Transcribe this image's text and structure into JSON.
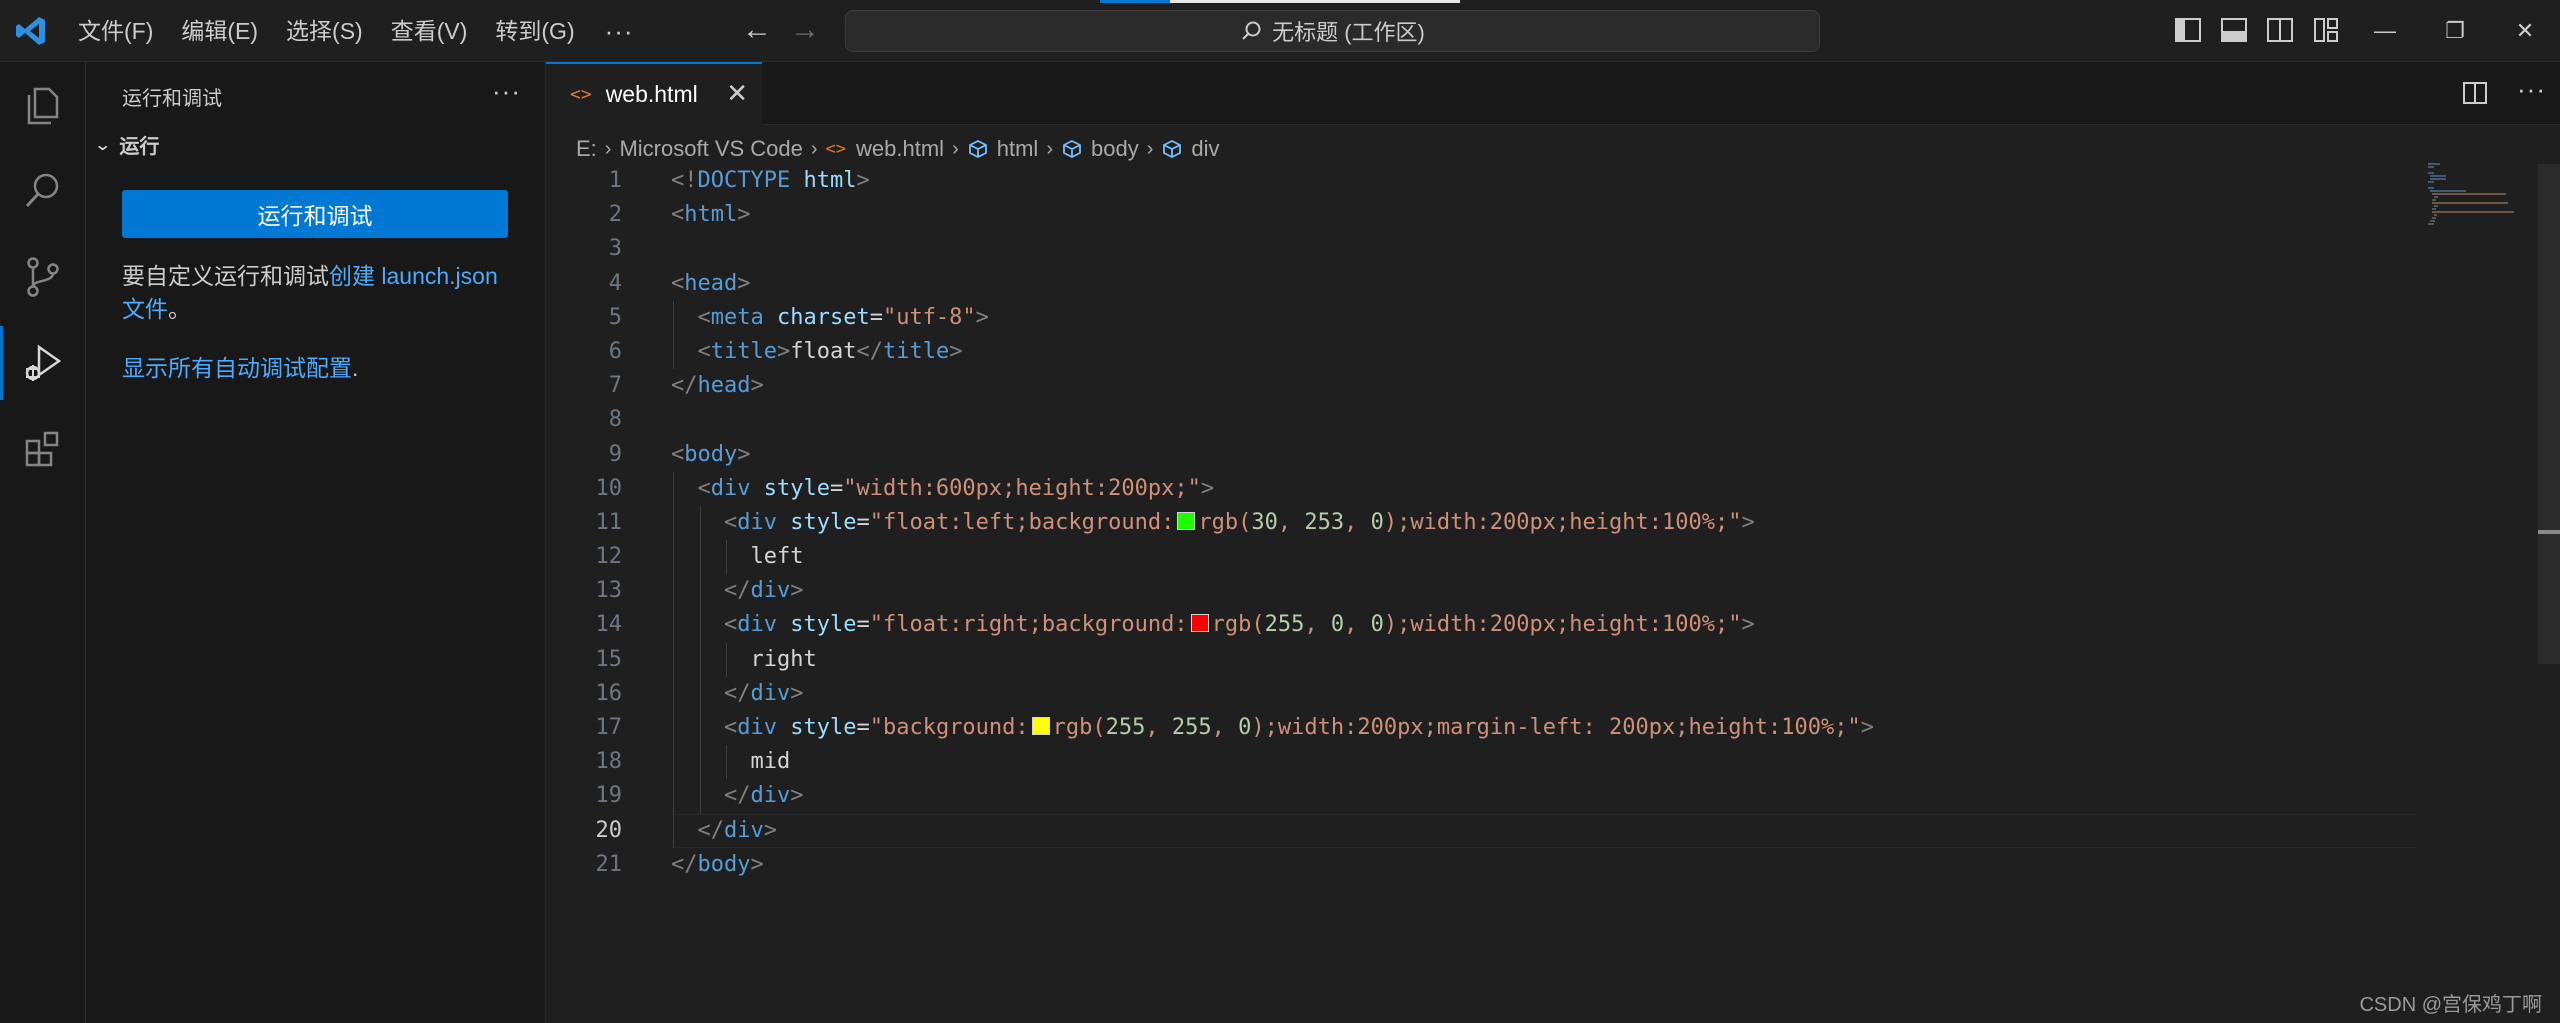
{
  "titlebar": {
    "menu": [
      "文件(F)",
      "编辑(E)",
      "选择(S)",
      "查看(V)",
      "转到(G)"
    ],
    "more": "···",
    "command_center": "无标题 (工作区)"
  },
  "sidebar": {
    "title": "运行和调试",
    "more": "···",
    "section": "运行",
    "run_button": "运行和调试",
    "hint_prefix": "要自定义运行和调试",
    "hint_link": "创建 launch.json 文件",
    "hint_suffix": "。",
    "show_configs": "显示所有自动调试配置",
    "show_configs_suffix": "."
  },
  "editor": {
    "tab_label": "web.html",
    "tab_icon": "<>",
    "close": "✕",
    "breadcrumb": [
      "E:",
      "Microsoft VS Code",
      "web.html",
      "html",
      "body",
      "div"
    ],
    "current_line": 20,
    "code": [
      {
        "n": "1",
        "indent": 0,
        "tokens": [
          [
            "p",
            "<!"
          ],
          [
            "t",
            "DOCTYPE "
          ],
          [
            "a",
            "html"
          ],
          [
            "p",
            ">"
          ]
        ]
      },
      {
        "n": "2",
        "indent": 0,
        "tokens": [
          [
            "p",
            "<"
          ],
          [
            "t",
            "html"
          ],
          [
            "p",
            ">"
          ]
        ]
      },
      {
        "n": "3",
        "indent": 0,
        "tokens": []
      },
      {
        "n": "4",
        "indent": 0,
        "tokens": [
          [
            "p",
            "<"
          ],
          [
            "t",
            "head"
          ],
          [
            "p",
            ">"
          ]
        ]
      },
      {
        "n": "5",
        "indent": 1,
        "tokens": [
          [
            "p",
            "<"
          ],
          [
            "t",
            "meta "
          ],
          [
            "a",
            "charset"
          ],
          [
            "x",
            "="
          ],
          [
            "s",
            "\"utf-8\""
          ],
          [
            "p",
            ">"
          ]
        ]
      },
      {
        "n": "6",
        "indent": 1,
        "tokens": [
          [
            "p",
            "<"
          ],
          [
            "t",
            "title"
          ],
          [
            "p",
            ">"
          ],
          [
            "x",
            "float"
          ],
          [
            "p",
            "</"
          ],
          [
            "t",
            "title"
          ],
          [
            "p",
            ">"
          ]
        ]
      },
      {
        "n": "7",
        "indent": 0,
        "tokens": [
          [
            "p",
            "</"
          ],
          [
            "t",
            "head"
          ],
          [
            "p",
            ">"
          ]
        ]
      },
      {
        "n": "8",
        "indent": 0,
        "tokens": []
      },
      {
        "n": "9",
        "indent": 0,
        "tokens": [
          [
            "p",
            "<"
          ],
          [
            "t",
            "body"
          ],
          [
            "p",
            ">"
          ]
        ]
      },
      {
        "n": "10",
        "indent": 1,
        "tokens": [
          [
            "p",
            "<"
          ],
          [
            "t",
            "div "
          ],
          [
            "a",
            "style"
          ],
          [
            "x",
            "="
          ],
          [
            "s",
            "\"width:600px;height:200px;\""
          ],
          [
            "p",
            ">"
          ]
        ]
      },
      {
        "n": "11",
        "indent": 2,
        "tokens": [
          [
            "p",
            "<"
          ],
          [
            "t",
            "div "
          ],
          [
            "a",
            "style"
          ],
          [
            "x",
            "="
          ],
          [
            "s",
            "\"float:left;background:"
          ],
          [
            "c",
            "#1efd00"
          ],
          [
            "s",
            "rgb("
          ],
          [
            "n",
            "30"
          ],
          [
            "s",
            ", "
          ],
          [
            "n",
            "253"
          ],
          [
            "s",
            ", "
          ],
          [
            "n",
            "0"
          ],
          [
            "s",
            ");width:200px;height:100%;\""
          ],
          [
            "p",
            ">"
          ]
        ]
      },
      {
        "n": "12",
        "indent": 3,
        "tokens": [
          [
            "x",
            "left"
          ]
        ]
      },
      {
        "n": "13",
        "indent": 2,
        "tokens": [
          [
            "p",
            "</"
          ],
          [
            "t",
            "div"
          ],
          [
            "p",
            ">"
          ]
        ]
      },
      {
        "n": "14",
        "indent": 2,
        "tokens": [
          [
            "p",
            "<"
          ],
          [
            "t",
            "div "
          ],
          [
            "a",
            "style"
          ],
          [
            "x",
            "="
          ],
          [
            "s",
            "\"float:right;background:"
          ],
          [
            "c",
            "#ff0000"
          ],
          [
            "s",
            "rgb("
          ],
          [
            "n",
            "255"
          ],
          [
            "s",
            ", "
          ],
          [
            "n",
            "0"
          ],
          [
            "s",
            ", "
          ],
          [
            "n",
            "0"
          ],
          [
            "s",
            ");width:200px;height:100%;\""
          ],
          [
            "p",
            ">"
          ]
        ]
      },
      {
        "n": "15",
        "indent": 3,
        "tokens": [
          [
            "x",
            "right"
          ]
        ]
      },
      {
        "n": "16",
        "indent": 2,
        "tokens": [
          [
            "p",
            "</"
          ],
          [
            "t",
            "div"
          ],
          [
            "p",
            ">"
          ]
        ]
      },
      {
        "n": "17",
        "indent": 2,
        "tokens": [
          [
            "p",
            "<"
          ],
          [
            "t",
            "div "
          ],
          [
            "a",
            "style"
          ],
          [
            "x",
            "="
          ],
          [
            "s",
            "\"background:"
          ],
          [
            "c",
            "#ffff00"
          ],
          [
            "s",
            "rgb("
          ],
          [
            "n",
            "255"
          ],
          [
            "s",
            ", "
          ],
          [
            "n",
            "255"
          ],
          [
            "s",
            ", "
          ],
          [
            "n",
            "0"
          ],
          [
            "s",
            ");width:200px;margin-left: 200px;height:100%;\""
          ],
          [
            "p",
            ">"
          ]
        ]
      },
      {
        "n": "18",
        "indent": 3,
        "tokens": [
          [
            "x",
            "mid"
          ]
        ]
      },
      {
        "n": "19",
        "indent": 2,
        "tokens": [
          [
            "p",
            "</"
          ],
          [
            "t",
            "div"
          ],
          [
            "p",
            ">"
          ]
        ]
      },
      {
        "n": "20",
        "indent": 1,
        "tokens": [
          [
            "p",
            "</"
          ],
          [
            "t",
            "div"
          ],
          [
            "p",
            ">"
          ]
        ]
      },
      {
        "n": "21",
        "indent": 0,
        "tokens": [
          [
            "p",
            "</"
          ],
          [
            "t",
            "body"
          ],
          [
            "p",
            ">"
          ]
        ]
      }
    ]
  },
  "watermark": "CSDN @宫保鸡丁啊",
  "colors": {
    "accent": "#0078d4",
    "link": "#4daafc",
    "tag": "#569cd6",
    "attr": "#9cdcfe",
    "string": "#ce9178"
  }
}
